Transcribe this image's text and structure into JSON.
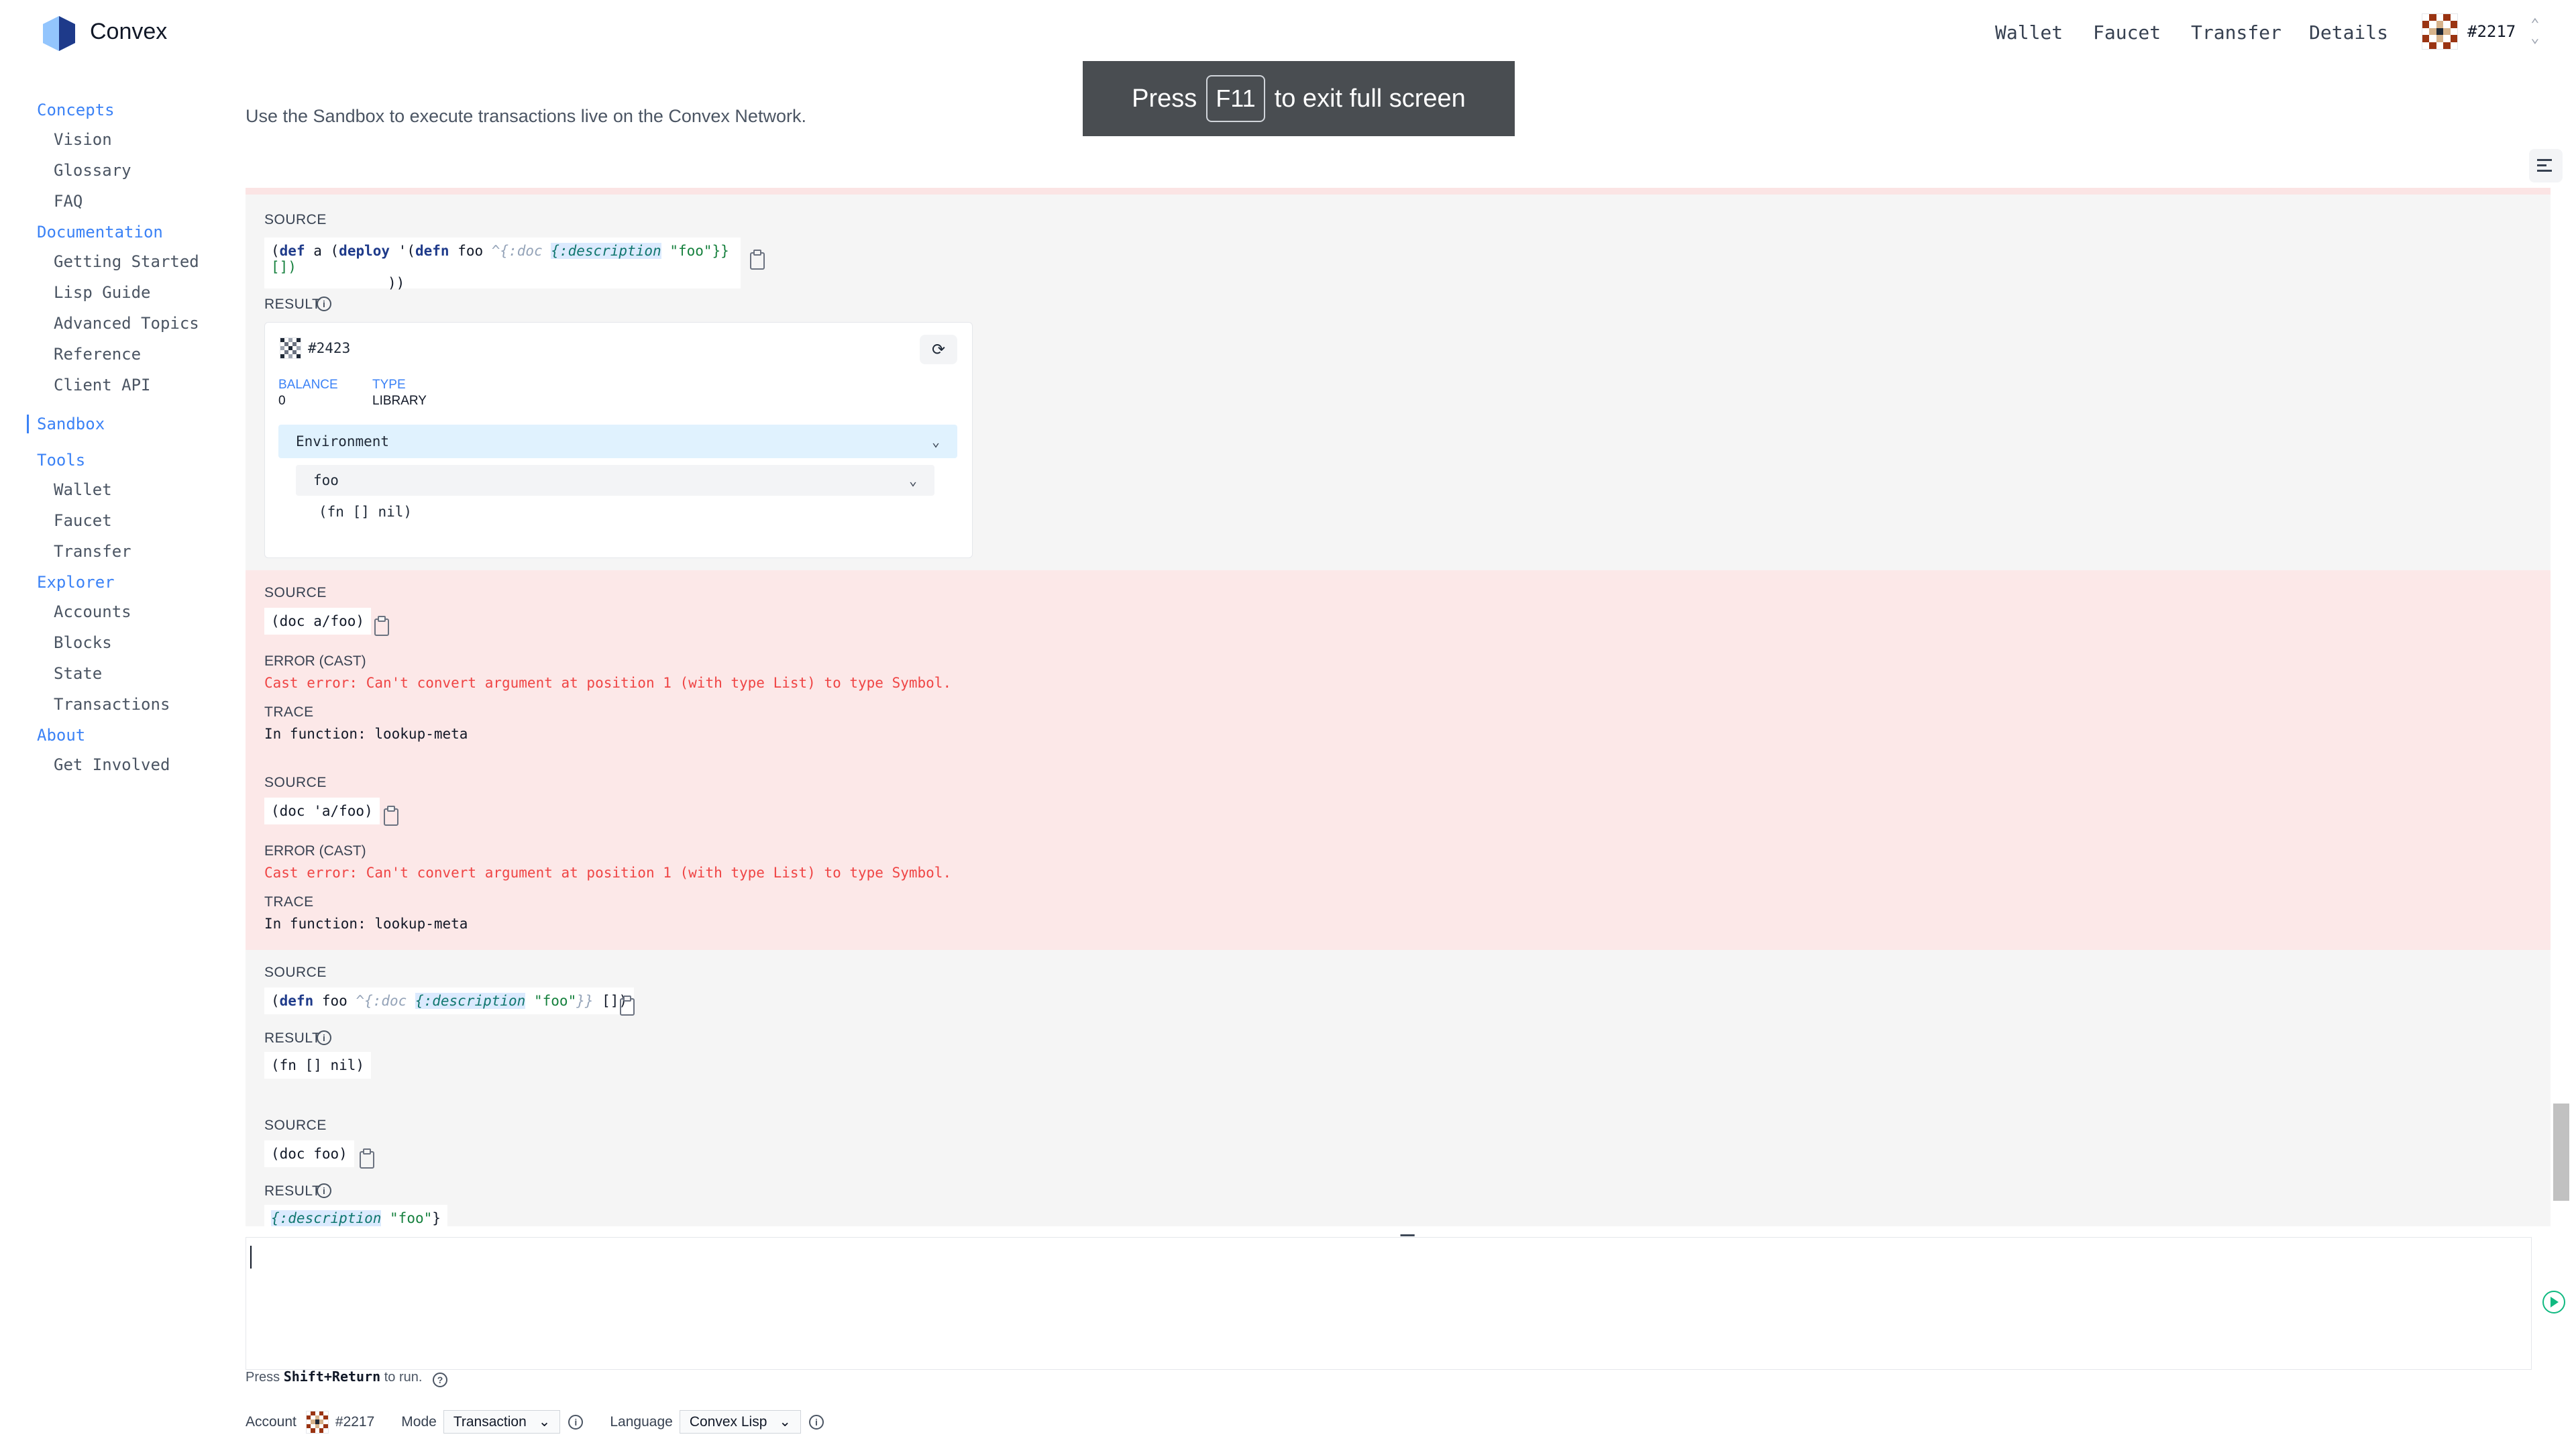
{
  "header": {
    "brand": "Convex",
    "nav": [
      "Wallet",
      "Faucet",
      "Transfer",
      "Details"
    ],
    "account_number": "#2217"
  },
  "toast": {
    "prefix": "Press",
    "key": "F11",
    "suffix": "to exit full screen"
  },
  "sidebar": {
    "sections": [
      {
        "title": "Concepts",
        "items": [
          "Vision",
          "Glossary",
          "FAQ"
        ]
      },
      {
        "title": "Documentation",
        "items": [
          "Getting Started",
          "Lisp Guide",
          "Advanced Topics",
          "Reference",
          "Client API"
        ]
      },
      {
        "title": "Sandbox",
        "items": [],
        "active": true
      },
      {
        "title": "Tools",
        "items": [
          "Wallet",
          "Faucet",
          "Transfer"
        ]
      },
      {
        "title": "Explorer",
        "items": [
          "Accounts",
          "Blocks",
          "State",
          "Transactions"
        ]
      },
      {
        "title": "About",
        "items": [
          "Get Involved"
        ]
      }
    ]
  },
  "intro": "Use the Sandbox to execute transactions live on the Convex Network.",
  "labels": {
    "source": "SOURCE",
    "result": "RESULT",
    "error_cast": "ERROR (CAST)",
    "trace": "TRACE",
    "balance": "BALANCE",
    "type": "TYPE"
  },
  "entries": {
    "e1": {
      "source_line1_tail": "\"foo\"}} []) ",
      "source_line2": "))",
      "account": "#2423",
      "balance": "0",
      "type": "LIBRARY",
      "environment": "Environment",
      "symbol": "foo",
      "value": "(fn [] nil)"
    },
    "e2": {
      "source": "(doc a/foo)",
      "error_msg": "Cast error: Can't convert argument at position 1 (with type List) to type Symbol.",
      "trace": "In function: lookup-meta"
    },
    "e3": {
      "source": "(doc 'a/foo)",
      "error_msg": "Cast error: Can't convert argument at position 1 (with type List) to type Symbol.",
      "trace": "In function: lookup-meta"
    },
    "e4": {
      "result": "(fn [] nil)"
    },
    "e5": {
      "source": "(doc foo)"
    }
  },
  "hint": {
    "prefix": "Press",
    "keys": "Shift+Return",
    "suffix": "to run."
  },
  "footer": {
    "account_label": "Account",
    "account": "#2217",
    "mode_label": "Mode",
    "mode": "Transaction",
    "language_label": "Language",
    "language": "Convex Lisp"
  },
  "colors": {
    "accent": "#3b82f6",
    "error_bg": "#fce8e8",
    "error_text": "#ef4444"
  }
}
